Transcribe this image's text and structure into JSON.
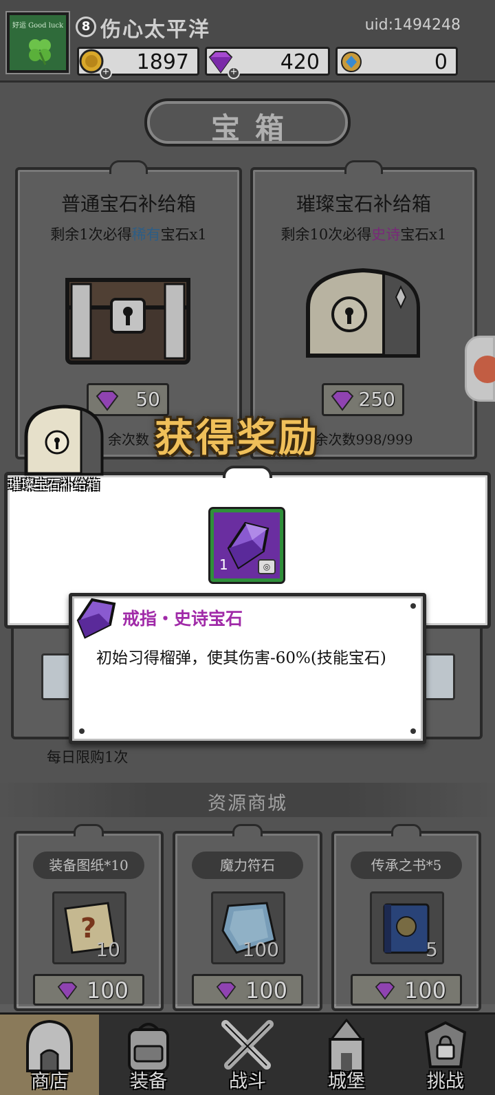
{
  "player": {
    "level": "8",
    "nickname": "伤心太平洋",
    "uid": "uid:1494248",
    "avatar_caption": "好运 Good luck"
  },
  "resources": {
    "gold": "1897",
    "diamond": "420",
    "orb": "0"
  },
  "page_title": "宝箱",
  "chests": [
    {
      "title": "普通宝石补给箱",
      "sub_prefix": "剩余1次必得",
      "sub_rarity": "稀有",
      "sub_suffix": "宝石x1",
      "price": "50",
      "remaining": "余次数"
    },
    {
      "title": "璀璨宝石补给箱",
      "sub_prefix": "剩余10次必得",
      "sub_rarity": "史诗",
      "sub_suffix": "宝石x1",
      "price": "250",
      "remaining": "余次数998/999"
    }
  ],
  "reward": {
    "title": "获得奖励",
    "chest_label": "璀璨宝石补给箱",
    "item_qty": "1"
  },
  "tooltip": {
    "name": "戒指・史诗宝石",
    "desc": "初始习得榴弹，使其伤害-60%(技能宝石)"
  },
  "daily_limit": "每日限购1次",
  "shop": {
    "header": "资源商城",
    "items": [
      {
        "tag": "装备图纸*10",
        "count": "10",
        "price": "100",
        "icon": "scroll-icon"
      },
      {
        "tag": "魔力符石",
        "count": "100",
        "price": "100",
        "icon": "rune-stone-icon"
      },
      {
        "tag": "传承之书*5",
        "count": "5",
        "price": "100",
        "icon": "book-icon"
      }
    ]
  },
  "nav": [
    {
      "label": "商店",
      "icon": "shop-icon",
      "active": true
    },
    {
      "label": "装备",
      "icon": "backpack-icon",
      "active": false
    },
    {
      "label": "战斗",
      "icon": "crossed-swords-icon",
      "active": false
    },
    {
      "label": "城堡",
      "icon": "castle-icon",
      "active": false
    },
    {
      "label": "挑战",
      "icon": "locked-armor-icon",
      "active": false
    }
  ],
  "colors": {
    "rare": "#2f6a9a",
    "epic": "#8a2a8a",
    "reward_title": "#f0c05a",
    "item_frame": "#2f8f3a",
    "item_bg": "#6a2ea0"
  }
}
